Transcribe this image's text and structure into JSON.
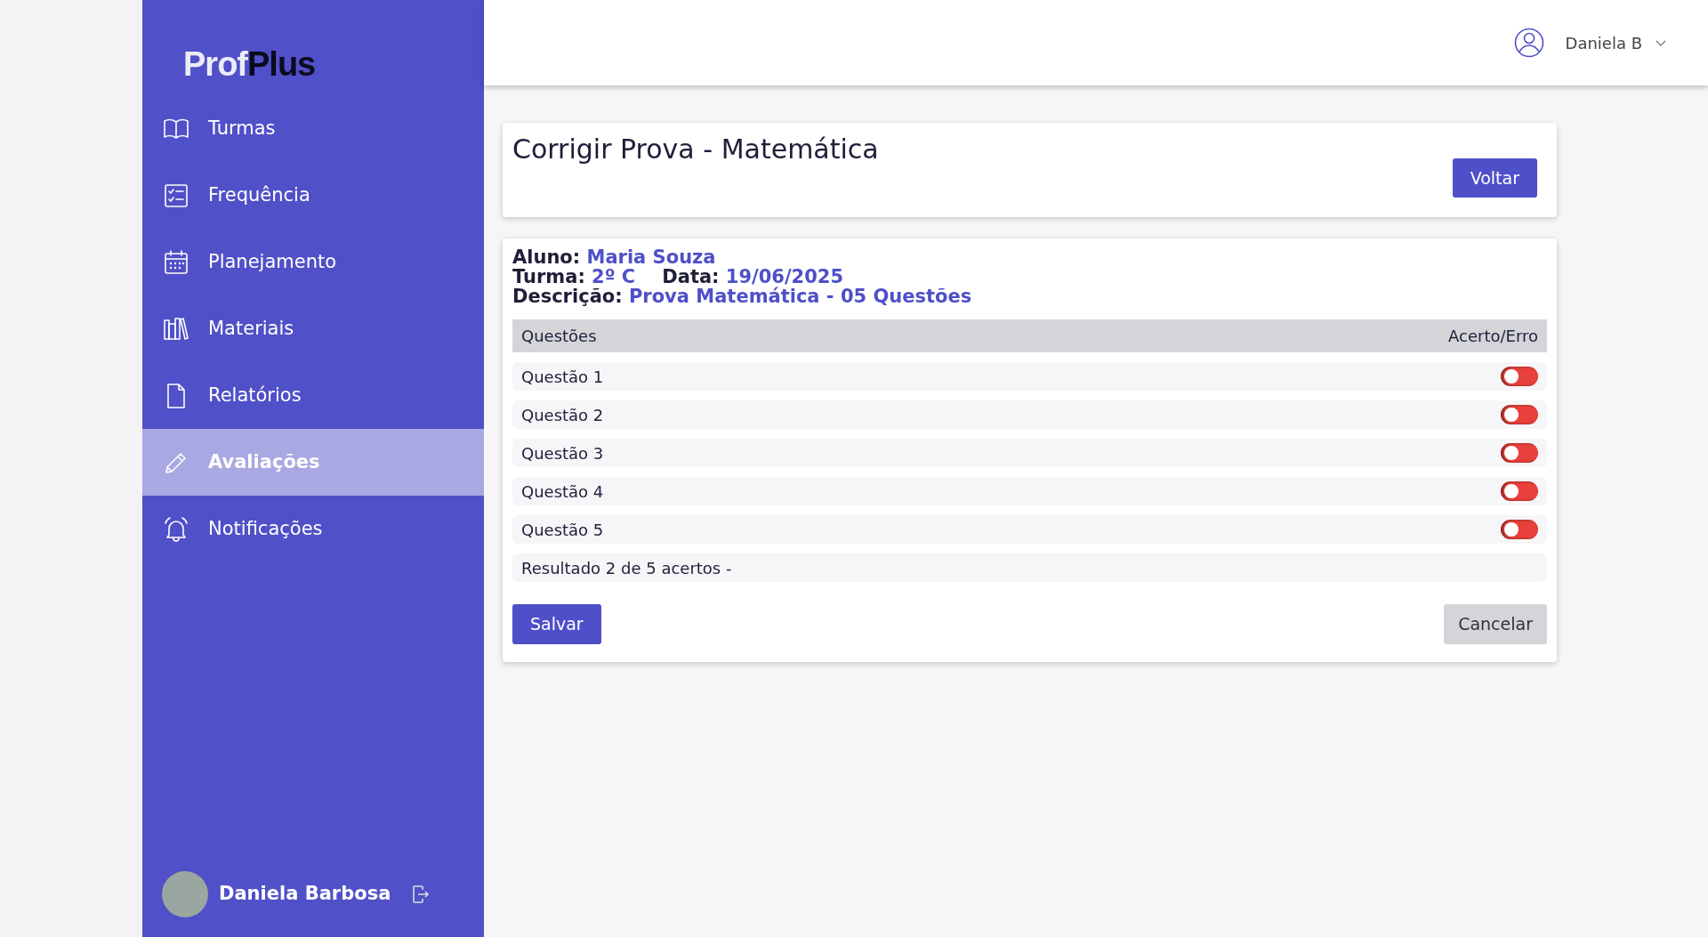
{
  "logo": [
    "Prof",
    "Plus"
  ],
  "sidebar": {
    "items": [
      {
        "label": "Turmas",
        "selected": false
      },
      {
        "label": "Frequência",
        "selected": false
      },
      {
        "label": "Planejamento",
        "selected": false
      },
      {
        "label": "Materiais",
        "selected": false
      },
      {
        "label": "Relatórios",
        "selected": false
      },
      {
        "label": "Avaliações",
        "selected": true
      },
      {
        "label": "Notificações",
        "selected": false
      }
    ],
    "user": {
      "name": "Daniela Barbosa"
    }
  },
  "header": {
    "user": "Daniela B"
  },
  "title_card": {
    "title": "Corrigir Prova - Matemática",
    "button": "Voltar"
  },
  "info": [
    [
      {
        "label": "Aluno:",
        "value": "Maria Souza"
      }
    ],
    [
      {
        "label": "Turma:",
        "value": "2º C"
      },
      {
        "label": "Data:",
        "value": "19/06/2025"
      }
    ],
    [
      {
        "label": "Descrição:",
        "value": "Prova Matemática - 05 Questões"
      }
    ]
  ],
  "table": {
    "columns": [
      "Questões",
      "Acerto/Erro"
    ],
    "rows": [
      {
        "label": "Questão 1",
        "checked": false
      },
      {
        "label": "Questão 2",
        "checked": false
      },
      {
        "label": "Questão 3",
        "checked": false
      },
      {
        "label": "Questão 4",
        "checked": false
      },
      {
        "label": "Questão 5",
        "checked": false
      }
    ],
    "result": "Resultado 2 de 5 acertos -"
  },
  "buttons": {
    "save": "Salvar",
    "cancel": "Cancelar"
  }
}
